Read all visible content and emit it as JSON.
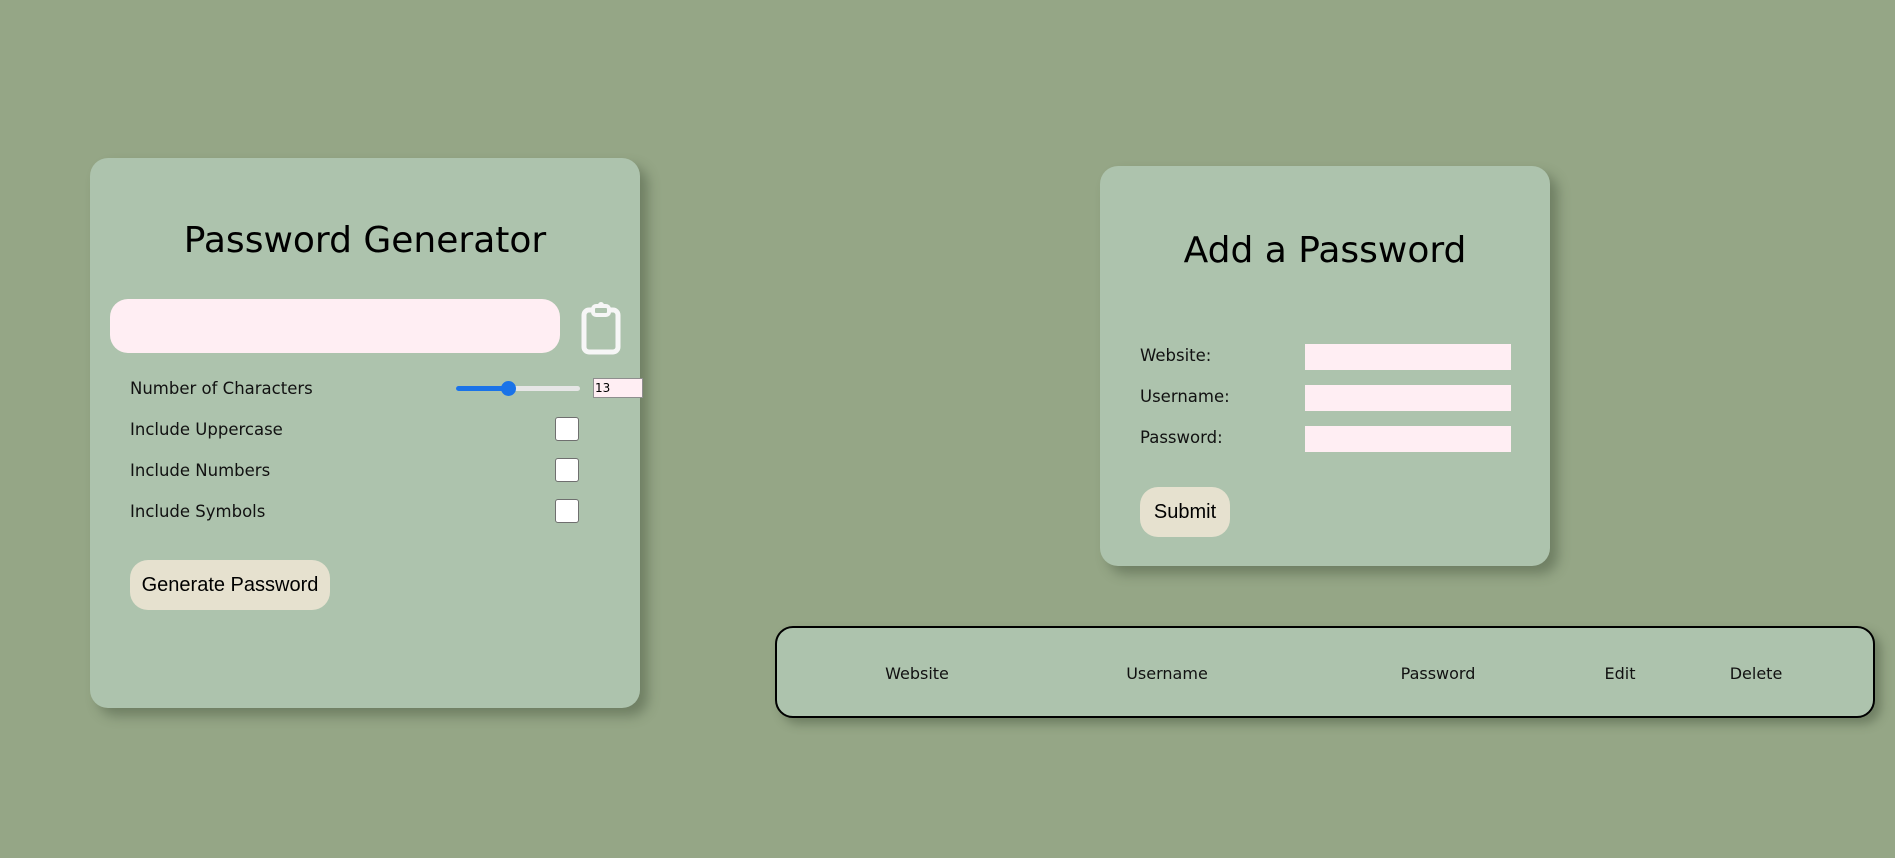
{
  "generator": {
    "title": "Password Generator",
    "output_value": "",
    "copy_icon": "clipboard-icon",
    "options": {
      "characters_label": "Number of Characters",
      "characters_value": "13",
      "characters_slider_fraction": 0.42,
      "uppercase_label": "Include Uppercase",
      "uppercase_checked": false,
      "numbers_label": "Include Numbers",
      "numbers_checked": false,
      "symbols_label": "Include Symbols",
      "symbols_checked": false
    },
    "generate_label": "Generate Password"
  },
  "add_form": {
    "title": "Add a Password",
    "website_label": "Website:",
    "website_value": "",
    "username_label": "Username:",
    "username_value": "",
    "password_label": "Password:",
    "password_value": "",
    "submit_label": "Submit"
  },
  "table": {
    "headers": [
      "Website",
      "Username",
      "Password",
      "Edit",
      "Delete"
    ],
    "rows": []
  },
  "colors": {
    "background": "#95a686",
    "card": "#adc3ad",
    "input": "#ffeef3",
    "button": "#e6e1cf",
    "accent": "#1a73e8"
  }
}
